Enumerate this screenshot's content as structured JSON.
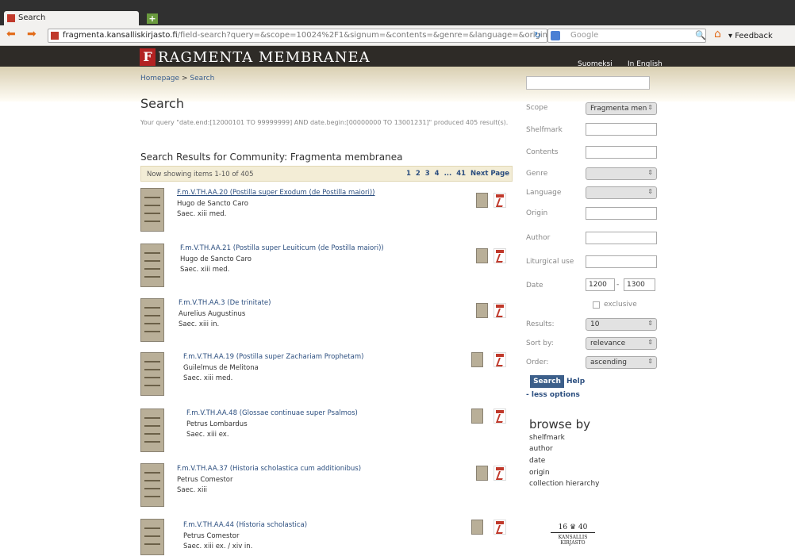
{
  "browser": {
    "tab_title": "Search",
    "url_domain": "fragmenta.kansalliskirjasto.fi",
    "url_path": "/field-search?query=&scope=10024%2F1&signum=&contents=&genre=&language=&origin=",
    "search_placeholder": "Google",
    "feedback": "Feedback"
  },
  "site": {
    "logo_letter": "F",
    "logo_text": "RAGMENTA MEMBRANEA",
    "lang_fi": "Suomeksi",
    "lang_en": "In English",
    "breadcrumb_home": "Homepage",
    "breadcrumb_sep": ">",
    "breadcrumb_current": "Search"
  },
  "main": {
    "heading": "Search",
    "query_text": "Your query \"date.end:[12000101 TO 99999999] AND date.begin:[00000000 TO 13001231]\" produced 405 result(s).",
    "results_heading": "Search Results for Community: Fragmenta membranea",
    "showing": "Now showing items 1-10 of 405",
    "pager": [
      "1",
      "2",
      "3",
      "4",
      "...",
      "41",
      "Next Page"
    ]
  },
  "results": [
    {
      "title": "F.m.V.TH.AA.20 (Postilla super Exodum (de Postilla maiori))",
      "author": "Hugo de Sancto Caro",
      "date": "Saec. xiii med."
    },
    {
      "title": "F.m.V.TH.AA.21 (Postilla super Leuiticum (de Postilla maiori))",
      "author": "Hugo de Sancto Caro",
      "date": "Saec. xiii med."
    },
    {
      "title": "F.m.V.TH.AA.3 (De trinitate)",
      "author": "Aurelius Augustinus",
      "date": "Saec. xiii in."
    },
    {
      "title": "F.m.V.TH.AA.19 (Postilla super Zachariam Prophetam)",
      "author": "Guilelmus de Melitona",
      "date": "Saec. xiii med."
    },
    {
      "title": "F.m.V.TH.AA.48 (Glossae continuae super Psalmos)",
      "author": "Petrus Lombardus",
      "date": "Saec. xiii ex."
    },
    {
      "title": "F.m.V.TH.AA.37 (Historia scholastica cum additionibus)",
      "author": "Petrus Comestor",
      "date": "Saec. xiii"
    },
    {
      "title": "F.m.V.TH.AA.44 (Historia scholastica)",
      "author": "Petrus Comestor",
      "date": "Saec. xiii ex. / xiv in."
    }
  ],
  "sidebar": {
    "scope_label": "Scope",
    "scope_value": "Fragmenta men",
    "shelfmark_label": "Shelfmark",
    "contents_label": "Contents",
    "genre_label": "Genre",
    "language_label": "Language",
    "origin_label": "Origin",
    "author_label": "Author",
    "liturgical_label": "Liturgical use",
    "date_label": "Date",
    "date_from": "1200",
    "date_to": "1300",
    "date_sep": "-",
    "exclusive_label": "exclusive",
    "results_label": "Results:",
    "results_value": "10",
    "sortby_label": "Sort by:",
    "sortby_value": "relevance",
    "order_label": "Order:",
    "order_value": "ascending",
    "search_button": "Search",
    "help": "Help",
    "less_options": "- less options",
    "browse_heading": "browse by",
    "browse_links": [
      "shelfmark",
      "author",
      "date",
      "origin",
      "collection hierarchy"
    ]
  },
  "footer_logo": {
    "year_left": "16",
    "year_right": "40",
    "line1": "KANSALLIS",
    "line2": "KIRJASTO"
  }
}
